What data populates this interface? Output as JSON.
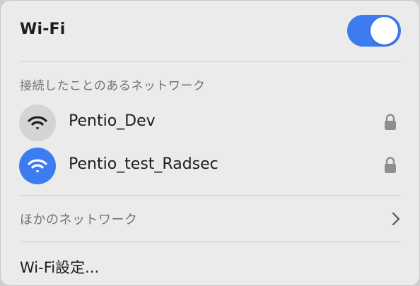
{
  "header": {
    "title": "Wi-Fi",
    "toggle_on": true
  },
  "known_networks": {
    "section_title": "接続したことのあるネットワーク",
    "items": [
      {
        "name": "Pentio_Dev",
        "icon": "wifi-icon",
        "secured": true,
        "connected": false
      },
      {
        "name": "Pentio_test_Radsec",
        "icon": "wifi-icon",
        "secured": true,
        "connected": true
      }
    ]
  },
  "other_networks": {
    "label": "ほかのネットワーク",
    "icon": "chevron-right-icon"
  },
  "settings": {
    "label": "Wi-Fi設定..."
  },
  "colors": {
    "accent": "#3d7cf0",
    "panel_bg": "#ebebeb",
    "secondary_text": "#737373",
    "inactive_icon_bg": "#d4d4d4"
  }
}
